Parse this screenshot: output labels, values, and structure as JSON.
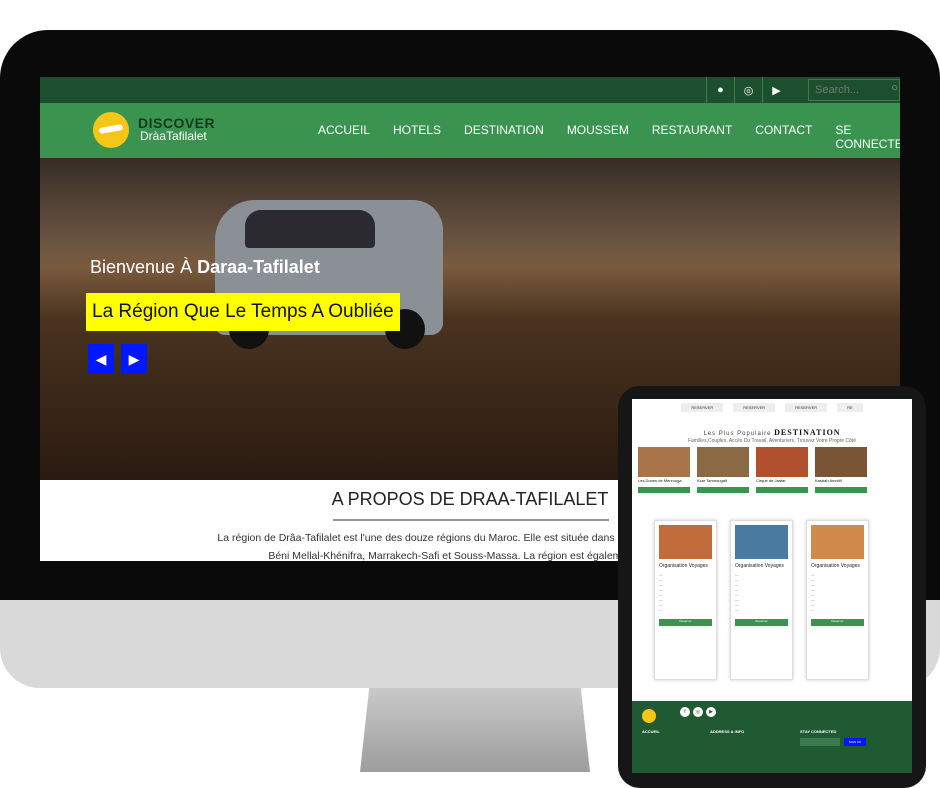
{
  "topbar": {
    "social_icons": [
      "facebook-icon",
      "instagram-icon",
      "youtube-icon"
    ],
    "search_placeholder": "Search..."
  },
  "brand": {
    "line1": "DISCOVER",
    "line2": "DràaTafilalet"
  },
  "nav": {
    "items": [
      "ACCUEIL",
      "HOTELS",
      "DESTINATION",
      "MOUSSEM",
      "RESTAURANT",
      "CONTACT",
      "SE CONNECTER"
    ]
  },
  "hero": {
    "welcome": "Bienvenue À",
    "welcome_bold": "Daraa-Tafilalet",
    "slogan": "La Région Que Le Temps A Oubliée",
    "prev": "◀",
    "next": "▶"
  },
  "about": {
    "title": "A PROPOS DE DRAA-TAFILALET",
    "line1": "La région de Drâa-Tafilalet est l'une des douze régions du Maroc. Elle est située dans le sud-est du pays et c",
    "line2": "Béni Mellal-Khénifra, Marrakech-Safi et Souss-Massa. La région est également bordée"
  },
  "tablet": {
    "reserve": [
      "RESERVER",
      "RESERVER",
      "RESERVER",
      "RE"
    ],
    "dest_pre": "Les Plus Populaire",
    "dest_title": "DESTINATION",
    "dest_desc": "Familles,Couples, Accès Du Travail, Aventuriers. Trouvez Votre Propre Côté",
    "destinations": [
      "Les Dunes de Merzouga",
      "Ksar Tamnougalt",
      "Cirque de Jaafar",
      "Kasbah Amridil"
    ],
    "cards": [
      {
        "title": "Organisation Voyages"
      },
      {
        "title": "Organisation Voyages"
      },
      {
        "title": "Organisation Voyages"
      }
    ],
    "card_btn": "Reserver",
    "footer_cols": [
      "ACCUEIL",
      "ADDRESS & INFO",
      "STAY CONNECTED"
    ],
    "signup": "SIGN UP",
    "colors": {
      "green": "#3a9450",
      "dark_green": "#1c4f2d",
      "yellow": "#ffff00",
      "blue": "#0018ff"
    }
  }
}
